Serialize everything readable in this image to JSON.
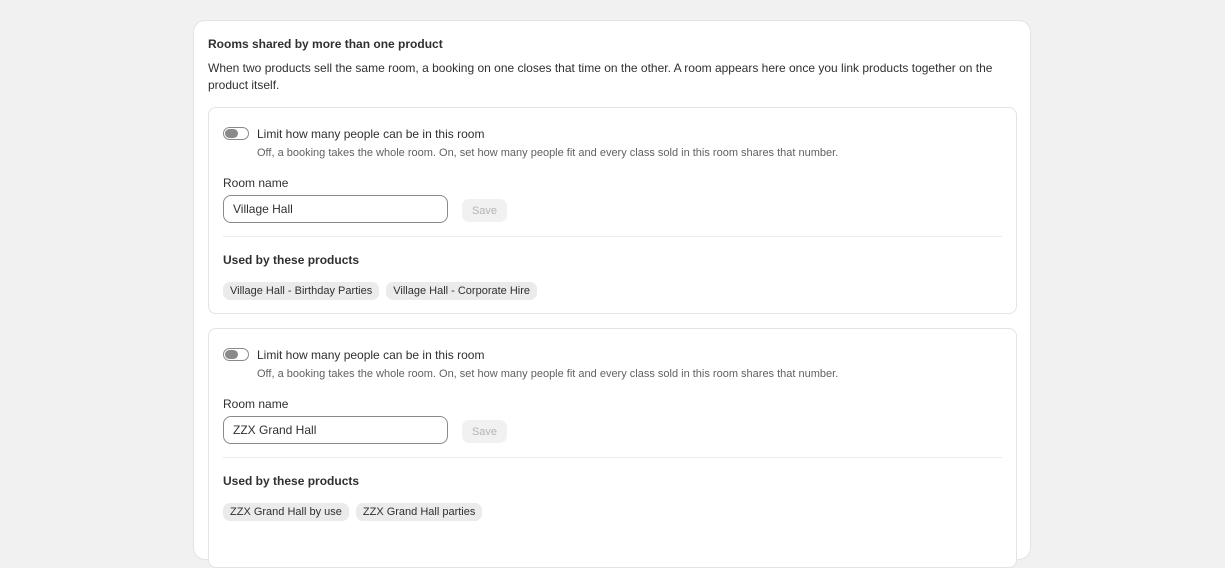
{
  "section": {
    "title": "Rooms shared by more than one product",
    "description": "When two products sell the same room, a booking on one closes that time on the other. A room appears here once you link products together on the product itself."
  },
  "rooms": [
    {
      "toggle_label": "Limit how many people can be in this room",
      "toggle_on": false,
      "toggle_help": "Off, a booking takes the whole room. On, set how many people fit and every class sold in this room shares that number.",
      "name_label": "Room name",
      "name_value": "Village Hall",
      "save_label": "Save",
      "products_title": "Used by these products",
      "products": [
        "Village Hall - Birthday Parties",
        "Village Hall - Corporate Hire"
      ]
    },
    {
      "toggle_label": "Limit how many people can be in this room",
      "toggle_on": false,
      "toggle_help": "Off, a booking takes the whole room. On, set how many people fit and every class sold in this room shares that number.",
      "name_label": "Room name",
      "name_value": "ZZX Grand Hall",
      "save_label": "Save",
      "products_title": "Used by these products",
      "products": [
        "ZZX Grand Hall by use",
        "ZZX Grand Hall parties"
      ]
    }
  ]
}
